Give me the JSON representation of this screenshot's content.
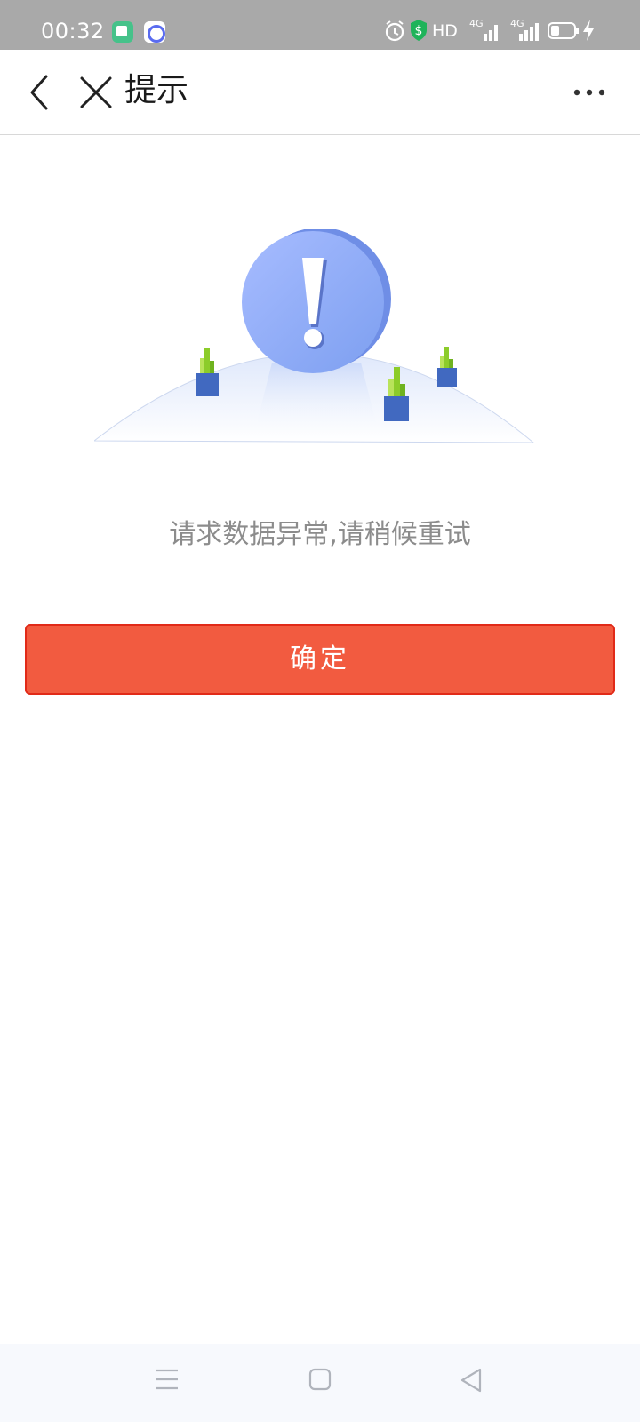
{
  "status_bar": {
    "time": "00:32",
    "network_label": "HD",
    "signal_1_label": "4G",
    "signal_2_label": "4G",
    "icons": [
      "app-icon-green",
      "app-icon-chat",
      "alarm-icon",
      "shield-icon",
      "hd-icon",
      "signal-4g-icon",
      "signal-4g-icon",
      "battery-icon",
      "charging-icon"
    ]
  },
  "header": {
    "title": "提示",
    "icons": [
      "back-icon",
      "close-icon",
      "more-icon"
    ]
  },
  "main": {
    "message": "请求数据异常,请稍候重试",
    "confirm_label": "确定"
  },
  "nav_bar": {
    "icons": [
      "menu-icon",
      "home-icon",
      "back-triangle-icon"
    ]
  },
  "colors": {
    "status_bar": "#a9a9a9",
    "accent_button": "#f25b40",
    "button_border": "#e12a18",
    "message_text": "#8c8c8c",
    "illustration_blue": "#7e9ff0"
  }
}
